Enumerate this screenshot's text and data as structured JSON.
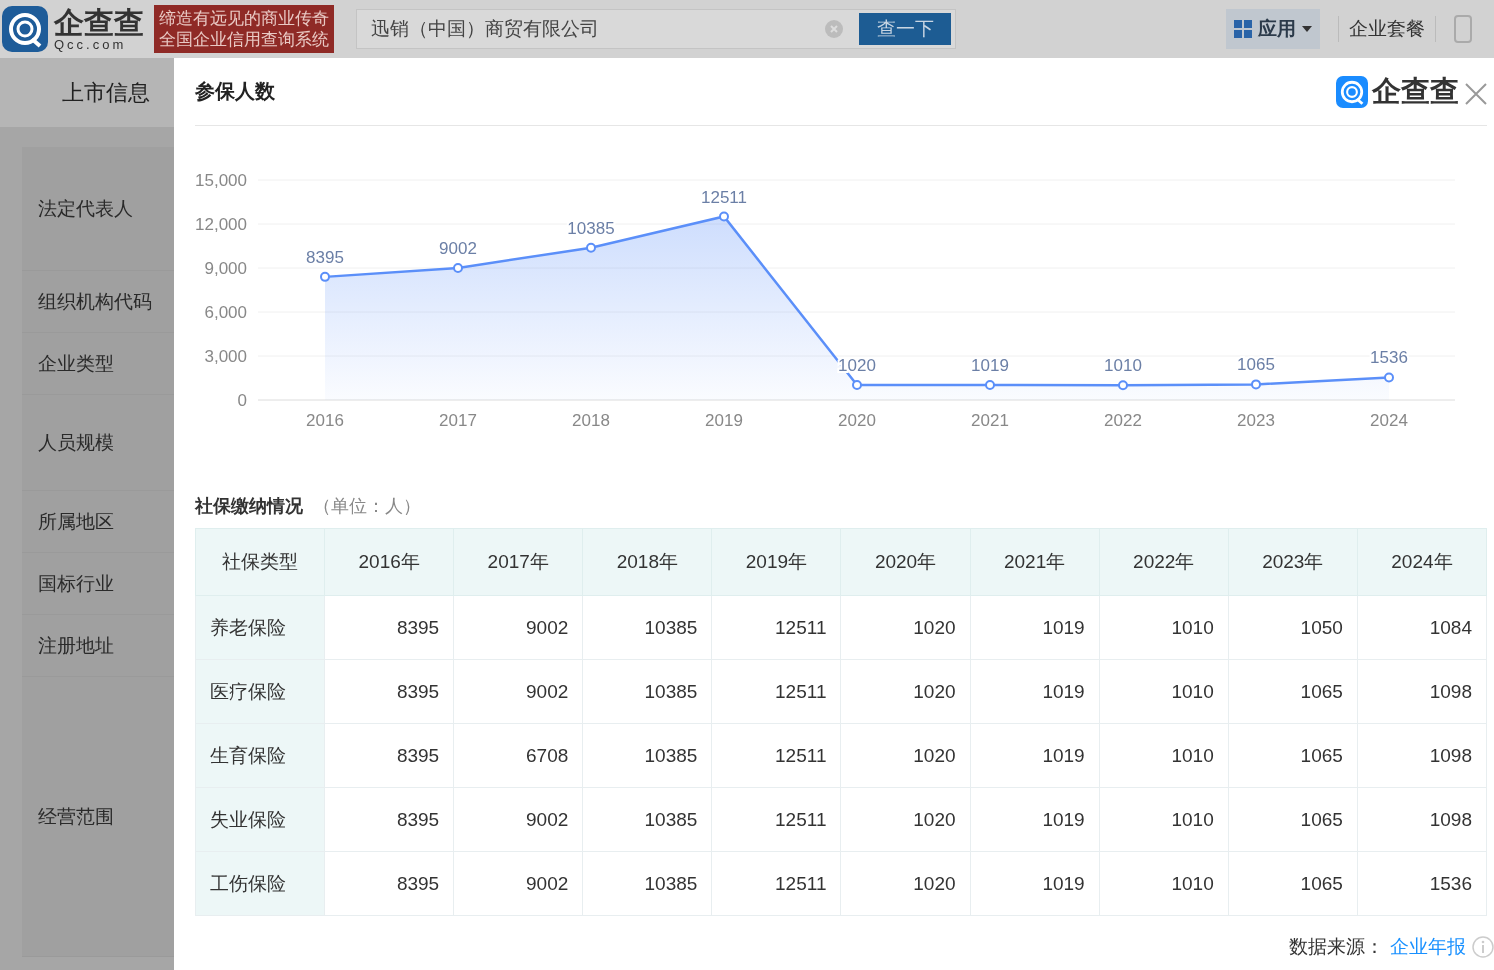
{
  "header": {
    "logo": {
      "name": "企查查",
      "domain": "Qcc.com"
    },
    "slogan": [
      "缔造有远见的商业传奇",
      "全国企业信用查询系统"
    ],
    "search": {
      "value": "迅销（中国）商贸有限公司",
      "button": "查一下"
    },
    "nav": [
      {
        "label": "应用",
        "kind": "menu"
      },
      {
        "label": "企业套餐",
        "kind": "link"
      }
    ]
  },
  "page": {
    "tab": "上市信息",
    "fields": [
      "法定代表人",
      "组织机构代码",
      "企业类型",
      "人员规模",
      "所属地区",
      "国标行业",
      "注册地址",
      "经营范围"
    ]
  },
  "dialog": {
    "title": "参保人数",
    "brand": "企查查",
    "chart_data": {
      "type": "area",
      "categories": [
        "2016",
        "2017",
        "2018",
        "2019",
        "2020",
        "2021",
        "2022",
        "2023",
        "2024"
      ],
      "grid": true,
      "series": [
        {
          "color": "#5b8ff9",
          "values": [
            8395,
            9002,
            10385,
            12511,
            1020,
            1019,
            1010,
            1065,
            1536
          ]
        }
      ],
      "ylim": [
        0,
        15000
      ],
      "yticks": [
        {
          "value": 0,
          "label": "0"
        },
        {
          "value": 3000,
          "label": "3,000"
        },
        {
          "value": 6000,
          "label": "6,000"
        },
        {
          "value": 9000,
          "label": "9,000"
        },
        {
          "value": 12000,
          "label": "12,000"
        },
        {
          "value": 15000,
          "label": "15,000"
        }
      ],
      "data_labels": true
    },
    "section": {
      "title": "社保缴纳情况",
      "unit": "（单位：人）"
    },
    "table": {
      "columns": [
        "社保类型",
        "2016年",
        "2017年",
        "2018年",
        "2019年",
        "2020年",
        "2021年",
        "2022年",
        "2023年",
        "2024年"
      ],
      "rows": [
        {
          "type": "养老保险",
          "values": [
            "8395",
            "9002",
            "10385",
            "12511",
            "1020",
            "1019",
            "1010",
            "1050",
            "1084"
          ]
        },
        {
          "type": "医疗保险",
          "values": [
            "8395",
            "9002",
            "10385",
            "12511",
            "1020",
            "1019",
            "1010",
            "1065",
            "1098"
          ]
        },
        {
          "type": "生育保险",
          "values": [
            "8395",
            "6708",
            "10385",
            "12511",
            "1020",
            "1019",
            "1010",
            "1065",
            "1098"
          ]
        },
        {
          "type": "失业保险",
          "values": [
            "8395",
            "9002",
            "10385",
            "12511",
            "1020",
            "1019",
            "1010",
            "1065",
            "1098"
          ]
        },
        {
          "type": "工伤保险",
          "values": [
            "8395",
            "9002",
            "10385",
            "12511",
            "1020",
            "1019",
            "1010",
            "1065",
            "1536"
          ]
        }
      ]
    },
    "source": {
      "label": "数据来源：",
      "link": "企业年报"
    }
  }
}
